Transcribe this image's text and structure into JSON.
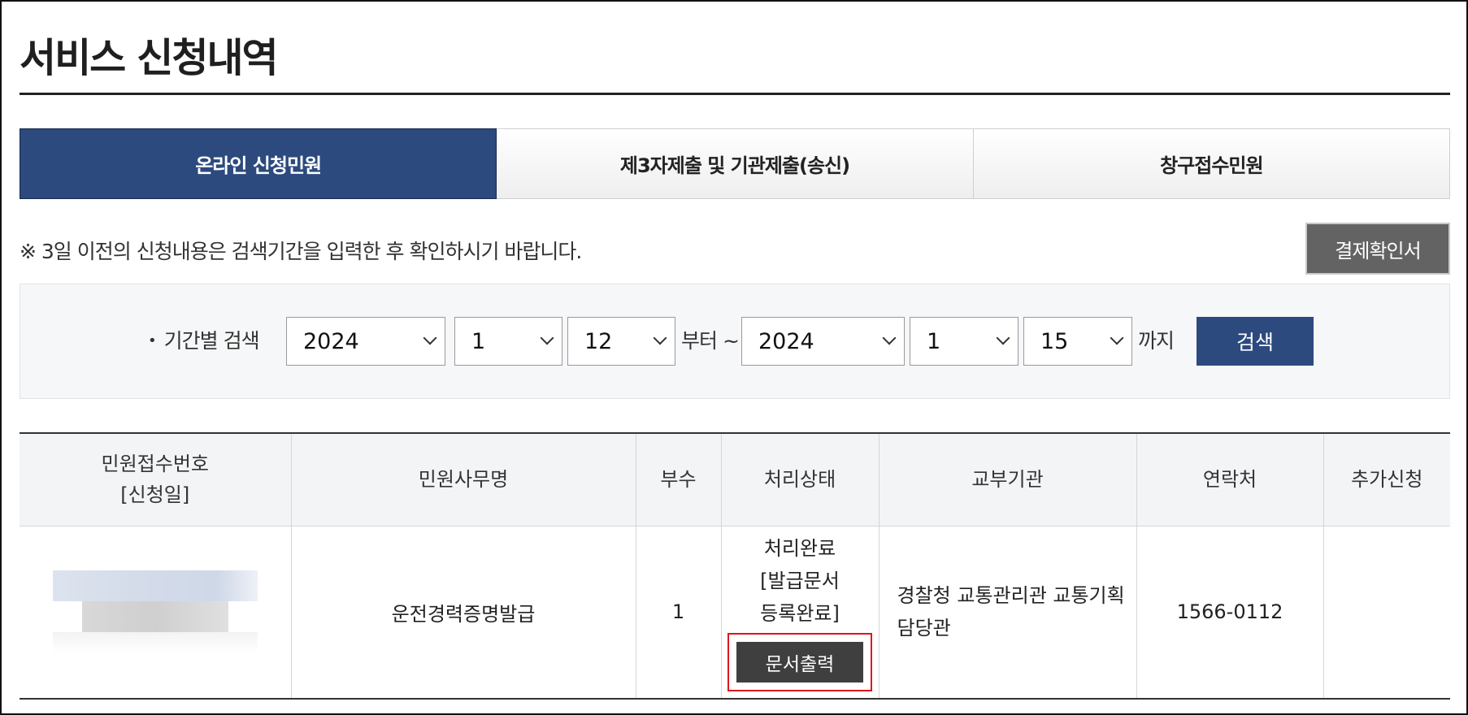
{
  "page": {
    "title": "서비스 신청내역"
  },
  "tabs": [
    {
      "label": "온라인 신청민원",
      "active": true
    },
    {
      "label": "제3자제출 및 기관제출(송신)",
      "active": false
    },
    {
      "label": "창구접수민원",
      "active": false
    }
  ],
  "notice": "※ 3일 이전의 신청내용은 검색기간을 입력한 후 확인하시기 바랍니다.",
  "receipt_button": "결제확인서",
  "search": {
    "label": "기간별 검색",
    "from": {
      "year": "2024",
      "month": "1",
      "day": "12"
    },
    "from_suffix": "부터 ~",
    "to": {
      "year": "2024",
      "month": "1",
      "day": "15"
    },
    "to_suffix": "까지",
    "button": "검색"
  },
  "table": {
    "headers": {
      "receipt_no_line1": "민원접수번호",
      "receipt_no_line2": "[신청일]",
      "service_name": "민원사무명",
      "copies": "부수",
      "status": "처리상태",
      "agency": "교부기관",
      "contact": "연락처",
      "additional": "추가신청"
    },
    "rows": [
      {
        "service_name": "운전경력증명발급",
        "copies": "1",
        "status_line1": "처리완료",
        "status_line2": "[발급문서",
        "status_line3": "등록완료]",
        "print_button": "문서출력",
        "agency_line1": "경찰청 교통관리관 교통기획",
        "agency_line2": "담당관",
        "contact": "1566-0112",
        "additional": ""
      }
    ]
  },
  "colors": {
    "accent": "#2c4a7e",
    "dark_button": "#636363",
    "print_button": "#3f3f3f",
    "highlight": "#e0141b"
  }
}
